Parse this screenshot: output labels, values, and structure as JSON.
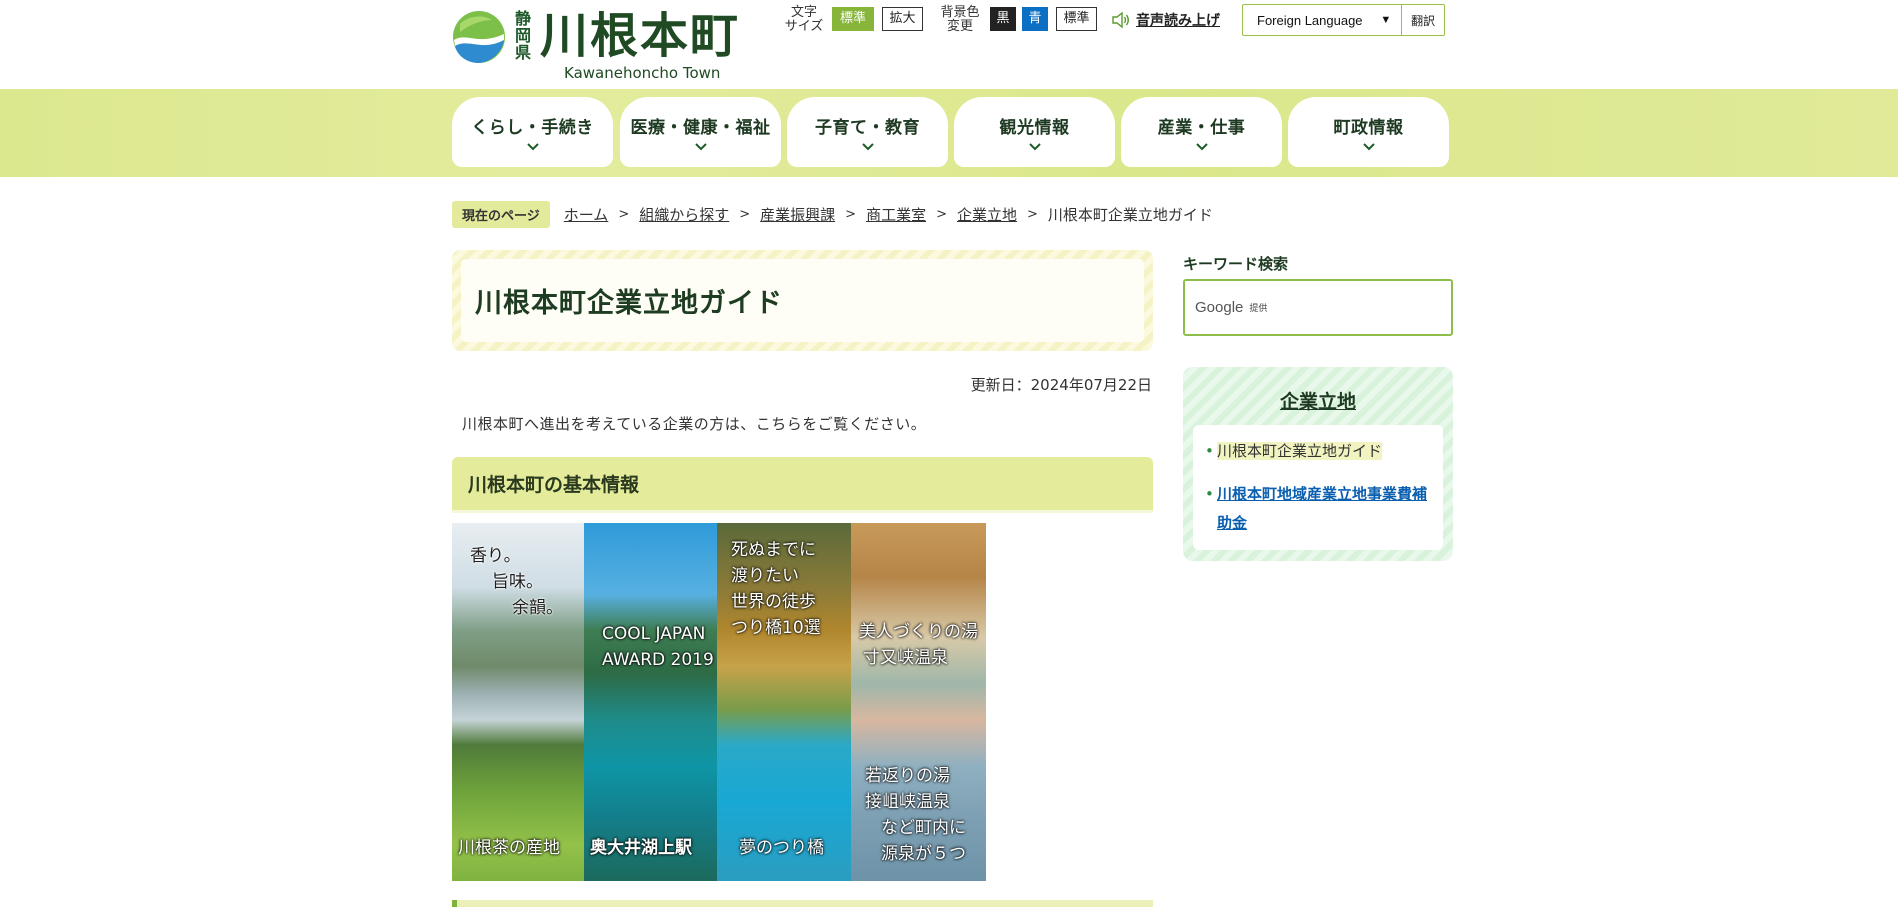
{
  "header": {
    "logo_pref": [
      "静",
      "岡",
      "県"
    ],
    "logo_name": "川根本町",
    "logo_en": "Kawanehoncho Town",
    "font_size_label": [
      "文字",
      "サイズ"
    ],
    "font_size_standard": "標準",
    "font_size_large": "拡大",
    "bg_color_label": [
      "背景色",
      "変更"
    ],
    "bg_black": "黒",
    "bg_blue": "青",
    "bg_standard": "標準",
    "voice_label": "音声読み上げ",
    "lang_select": "Foreign Language",
    "translate_button": "翻訳",
    "colors": {
      "brand_green": "#86b53a",
      "bg_blue": "#0b6fc4"
    }
  },
  "nav": {
    "items": [
      {
        "label": "くらし・手続き"
      },
      {
        "label": "医療・健康・福祉"
      },
      {
        "label": "子育て・教育"
      },
      {
        "label": "観光情報"
      },
      {
        "label": "産業・仕事"
      },
      {
        "label": "町政情報"
      }
    ]
  },
  "breadcrumb": {
    "badge": "現在のページ",
    "links": [
      "ホーム",
      "組織から探す",
      "産業振興課",
      "商工業室",
      "企業立地"
    ],
    "current": "川根本町企業立地ガイド"
  },
  "main": {
    "title": "川根本町企業立地ガイド",
    "updated": "更新日：2024年07月22日",
    "intro": "川根本町へ進出を考えている企業の方は、こちらをご覧ください。",
    "section_heading": "川根本町の基本情報",
    "gallery": {
      "panel1": {
        "top": [
          "香り。",
          "旨味。",
          "余韻。"
        ],
        "bottom": "川根茶の産地"
      },
      "panel2": {
        "mid": [
          "COOL JAPAN",
          "AWARD 2019"
        ],
        "bottom": "奥大井湖上駅"
      },
      "panel3": {
        "top": [
          "死ぬまでに",
          "渡りたい",
          "世界の徒歩",
          "つり橋10選"
        ],
        "bottom": "夢のつり橋"
      },
      "panel4": {
        "top": [
          "美人づくりの湯",
          "寸又峡温泉"
        ],
        "bottom": [
          "若返りの湯",
          "接岨峡温泉",
          "など町内に",
          "源泉が５つ"
        ]
      }
    }
  },
  "sidebar": {
    "keyword_label": "キーワード検索",
    "search_brand": "Google",
    "search_provided": "提供",
    "box_title": "企業立地",
    "items": [
      {
        "label": "川根本町企業立地ガイド"
      },
      {
        "label": "川根本町地域産業立地事業費補助金"
      }
    ]
  }
}
